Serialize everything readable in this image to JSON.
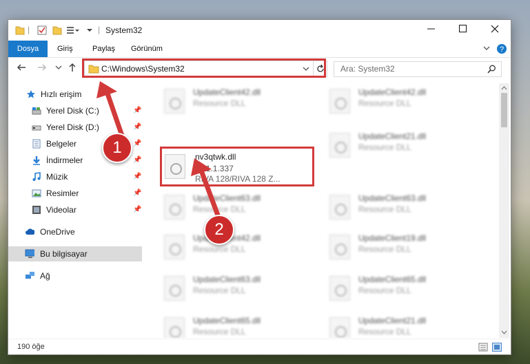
{
  "window": {
    "title": "System32"
  },
  "ribbon": {
    "tabs": [
      {
        "label": "Dosya"
      },
      {
        "label": "Giriş"
      },
      {
        "label": "Paylaş"
      },
      {
        "label": "Görünüm"
      }
    ]
  },
  "address": {
    "path": "C:\\Windows\\System32"
  },
  "search": {
    "placeholder": "Ara: System32"
  },
  "nav": {
    "quick_access": "Hızlı erişim",
    "items": [
      {
        "label": "Yerel Disk (C:)"
      },
      {
        "label": "Yerel Disk (D:)"
      },
      {
        "label": "Belgeler"
      },
      {
        "label": "İndirmeler"
      },
      {
        "label": "Müzik"
      },
      {
        "label": "Resimler"
      },
      {
        "label": "Videolar"
      }
    ],
    "onedrive": "OneDrive",
    "this_pc": "Bu bilgisayar",
    "network": "Ağ"
  },
  "files": {
    "highlighted": {
      "name": "nv3qtwk.dll",
      "version": "4.11.1.337",
      "description": "RIVA 128/RIVA 128 Z..."
    },
    "left_column": [
      {
        "name": "UpdateClient42.dll",
        "description": "Resource DLL"
      },
      {
        "name": "UpdateClient63.dll",
        "description": "Resource DLL"
      },
      {
        "name": "UpdateClient42.dll",
        "description": "Resource DLL"
      },
      {
        "name": "UpdateClient63.dll",
        "description": "Resource DLL"
      },
      {
        "name": "UpdateClient65.dll",
        "description": "Resource DLL"
      }
    ],
    "right_column": [
      {
        "name": "UpdateClient42.dll",
        "description": "Resource DLL"
      },
      {
        "name": "UpdateClient21.dll",
        "description": "Resource DLL"
      },
      {
        "name": "UpdateClient63.dll",
        "description": "Resource DLL"
      },
      {
        "name": "UpdateClient19.dll",
        "description": "Resource DLL"
      },
      {
        "name": "UpdateClient65.dll",
        "description": "Resource DLL"
      },
      {
        "name": "UpdateClient21.dll",
        "description": "Resource DLL"
      }
    ]
  },
  "status": {
    "count": "190 öğe"
  },
  "callouts": [
    "1",
    "2"
  ],
  "colors": {
    "accent": "#1979ca",
    "highlight": "#d23a3a",
    "callout": "#cc2b2b"
  }
}
